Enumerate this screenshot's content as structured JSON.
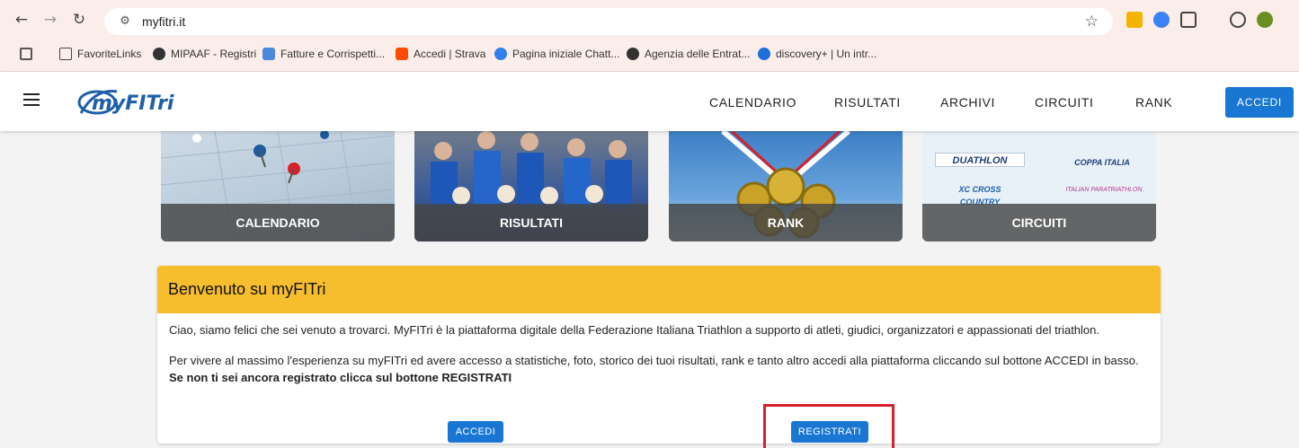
{
  "browser": {
    "url": "myfitri.it",
    "bookmarks": [
      "FavoriteLinks",
      "MIPAAF - Registri",
      "Fatture e Corrispetti...",
      "Accedi | Strava",
      "Pagina iniziale Chatt...",
      "Agenzia delle Entrat...",
      "discovery+ | Un intr..."
    ]
  },
  "header": {
    "logo_text": "myFITri",
    "nav": [
      "CALENDARIO",
      "RISULTATI",
      "ARCHIVI",
      "CIRCUITI",
      "RANK"
    ],
    "accedi_label": "ACCEDI"
  },
  "tiles": [
    "CALENDARIO",
    "RISULTATI",
    "RANK",
    "CIRCUITI"
  ],
  "circuit_logos": [
    "DUATHLON",
    "COPPA ITALIA",
    "XC CROSS COUNTRY",
    "ITALIAN PARATRIATHLON"
  ],
  "welcome": {
    "title": "Benvenuto su myFITri",
    "paragraph1": "Ciao, siamo felici che sei venuto a trovarci. MyFITri è la piattaforma digitale della Federazione Italiana Triathlon a supporto di atleti, giudici, organizzatori e appassionati del triathlon.",
    "paragraph2": "Per vivere al massimo l'esperienza su myFITri ed avere accesso a statistiche, foto, storico dei tuoi risultati, rank e tanto altro accedi alla piattaforma cliccando sul bottone ACCEDI in basso.",
    "paragraph2_bold": "Se non ti sei ancora registrato clicca sul bottone REGISTRATI",
    "accedi_label": "ACCEDI",
    "registrati_label": "REGISTRATI"
  },
  "colors": {
    "accent": "#1976d2",
    "card_header": "#f6bd2d",
    "highlight": "#d6202a"
  }
}
